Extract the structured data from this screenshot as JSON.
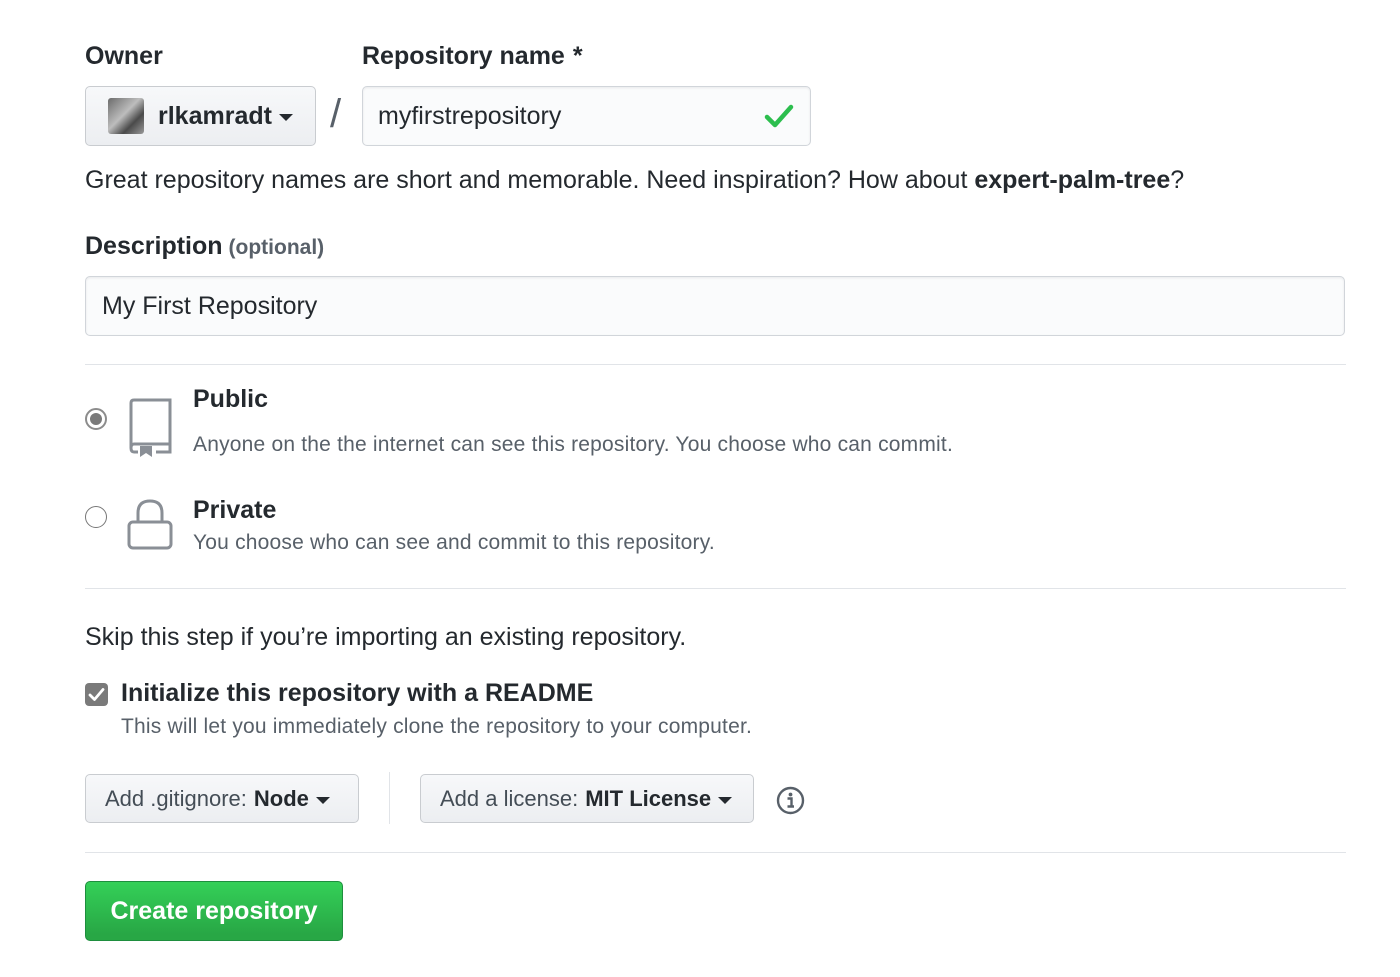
{
  "owner": {
    "label": "Owner",
    "username": "rlkamradt"
  },
  "repository_name": {
    "label": "Repository name",
    "required_marker": "*",
    "value": "myfirstrepository",
    "separator": "/"
  },
  "name_hint": {
    "prefix": "Great repository names are short and memorable. Need inspiration? How about ",
    "suggestion": "expert-palm-tree",
    "suffix": "?"
  },
  "description": {
    "label": "Description",
    "optional_tag": "(optional)",
    "value": "My First Repository"
  },
  "visibility": {
    "selected": "public",
    "public": {
      "title": "Public",
      "description": "Anyone on the the internet can see this repository. You choose who can commit.",
      "icon": "repo-book-icon"
    },
    "private": {
      "title": "Private",
      "description": "You choose who can see and commit to this repository.",
      "icon": "lock-icon"
    }
  },
  "initialize": {
    "skip_text": "Skip this step if you’re importing an existing repository.",
    "readme_label": "Initialize this repository with a README",
    "readme_checked": true,
    "readme_note": "This will let you immediately clone the repository to your computer."
  },
  "gitignore": {
    "label": "Add .gitignore:",
    "value": "Node"
  },
  "license": {
    "label": "Add a license:",
    "value": "MIT License"
  },
  "submit": {
    "label": "Create repository"
  },
  "colors": {
    "success_green": "#28a745",
    "check_green": "#2cbe4e",
    "text": "#24292e",
    "muted": "#586069"
  }
}
